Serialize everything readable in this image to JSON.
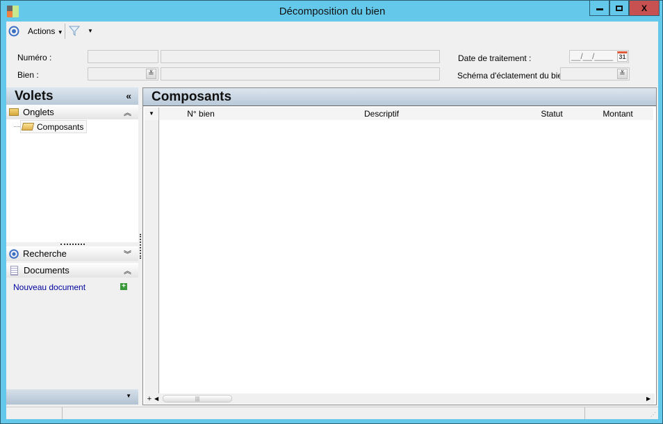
{
  "window": {
    "title": "Décomposition du bien",
    "minimize": "▬",
    "maximize": "□",
    "close": "X"
  },
  "toolbar": {
    "actions_label": "Actions",
    "filter_icon": "filter-icon"
  },
  "form": {
    "numero_label": "Numéro :",
    "numero_value": "",
    "numero_desc": "",
    "bien_label": "Bien :",
    "bien_value": "",
    "bien_desc": "",
    "date_label": "Date de traitement :",
    "date_value": "__/__/____",
    "calendar_day": "31",
    "schema_label": "Schéma d'éclatement du bien :",
    "schema_value": ""
  },
  "left_panel": {
    "title": "Volets",
    "sections": {
      "onglets": {
        "label": "Onglets",
        "items": [
          "Composants"
        ]
      },
      "recherche": {
        "label": "Recherche"
      },
      "documents": {
        "label": "Documents",
        "link": "Nouveau document"
      }
    }
  },
  "main": {
    "title": "Composants",
    "columns": [
      "N° bien",
      "Descriptif",
      "Statut",
      "Montant"
    ],
    "rows": []
  },
  "colors": {
    "window_border": "#63c8ea",
    "close_button": "#c75050",
    "link": "#0000a0"
  }
}
